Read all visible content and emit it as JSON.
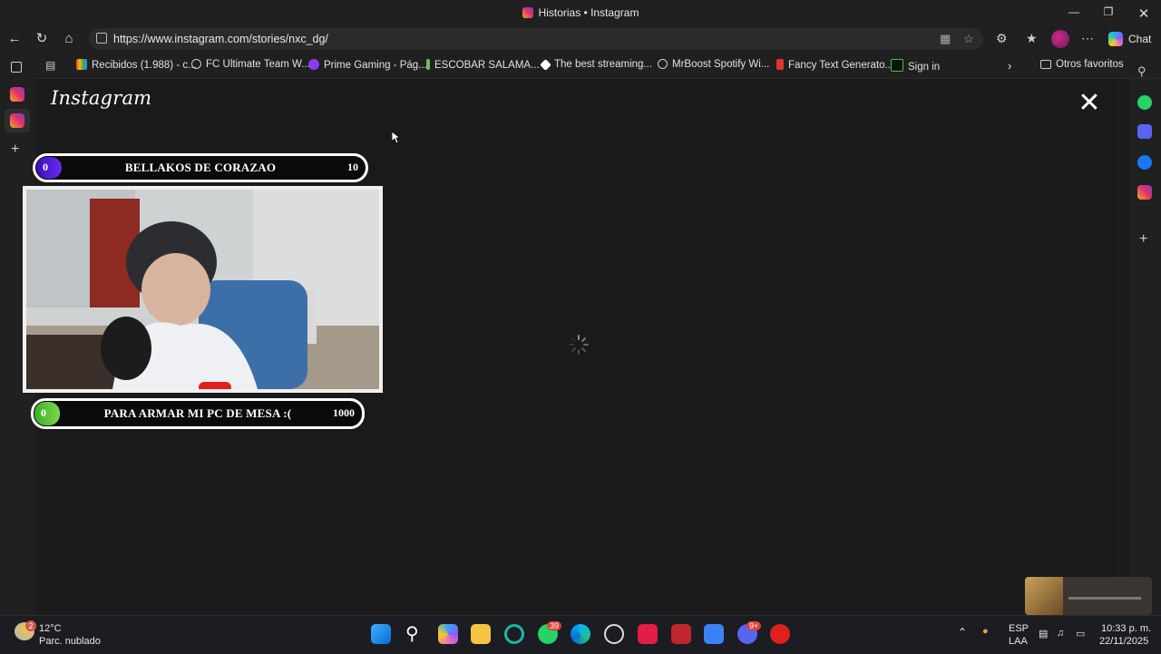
{
  "window": {
    "title": "Historias • Instagram"
  },
  "nav": {
    "url": "https://www.instagram.com/stories/nxc_dg/",
    "chat_label": "Chat"
  },
  "bookmarks": {
    "items": [
      {
        "label": "Recibidos (1.988) - c..."
      },
      {
        "label": "FC Ultimate Team W..."
      },
      {
        "label": "Prime Gaming - Pág..."
      },
      {
        "label": "ESCOBAR SALAMA..."
      },
      {
        "label": "The best streaming..."
      },
      {
        "label": "MrBoost Spotify Wi..."
      },
      {
        "label": "Fancy Text Generato..."
      },
      {
        "label": "Sign in"
      }
    ],
    "other_favorites": "Otros favoritos"
  },
  "story": {
    "brand": "Instagram",
    "goal_top": {
      "start": "0",
      "label": "BELLAKOS DE CORAZAO",
      "end": "10",
      "progress": 0.0
    },
    "goal_bottom": {
      "start": "0",
      "label": "PARA ARMAR MI PC DE MESA :(",
      "end": "1000",
      "progress": 0.0
    }
  },
  "taskbar": {
    "weather_temp": "12°C",
    "weather_desc": "Parc. nublado",
    "weather_badge": "2",
    "whatsapp_badge": "39",
    "discord_badge": "9+",
    "lang_top": "ESP",
    "lang_bottom": "LAA",
    "time": "10:33 p. m.",
    "date": "22/11/2025"
  },
  "colors": {
    "goal_top_accent": "#5b1fd6",
    "goal_bottom_accent": "#5ecb3a",
    "accent_red": "#e0201f"
  }
}
